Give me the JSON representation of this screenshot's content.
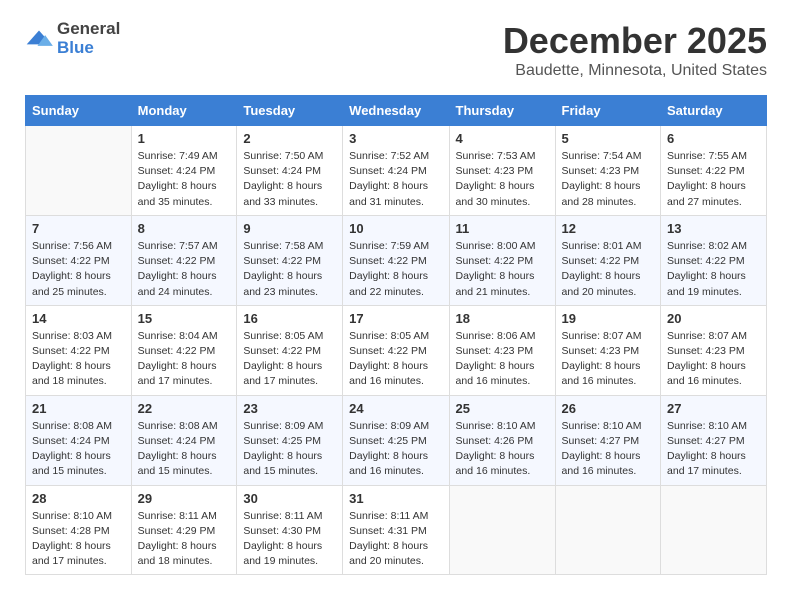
{
  "logo": {
    "general": "General",
    "blue": "Blue"
  },
  "header": {
    "month": "December 2025",
    "location": "Baudette, Minnesota, United States"
  },
  "weekdays": [
    "Sunday",
    "Monday",
    "Tuesday",
    "Wednesday",
    "Thursday",
    "Friday",
    "Saturday"
  ],
  "weeks": [
    [
      {
        "day": "",
        "content": ""
      },
      {
        "day": "1",
        "content": "Sunrise: 7:49 AM\nSunset: 4:24 PM\nDaylight: 8 hours\nand 35 minutes."
      },
      {
        "day": "2",
        "content": "Sunrise: 7:50 AM\nSunset: 4:24 PM\nDaylight: 8 hours\nand 33 minutes."
      },
      {
        "day": "3",
        "content": "Sunrise: 7:52 AM\nSunset: 4:24 PM\nDaylight: 8 hours\nand 31 minutes."
      },
      {
        "day": "4",
        "content": "Sunrise: 7:53 AM\nSunset: 4:23 PM\nDaylight: 8 hours\nand 30 minutes."
      },
      {
        "day": "5",
        "content": "Sunrise: 7:54 AM\nSunset: 4:23 PM\nDaylight: 8 hours\nand 28 minutes."
      },
      {
        "day": "6",
        "content": "Sunrise: 7:55 AM\nSunset: 4:22 PM\nDaylight: 8 hours\nand 27 minutes."
      }
    ],
    [
      {
        "day": "7",
        "content": "Sunrise: 7:56 AM\nSunset: 4:22 PM\nDaylight: 8 hours\nand 25 minutes."
      },
      {
        "day": "8",
        "content": "Sunrise: 7:57 AM\nSunset: 4:22 PM\nDaylight: 8 hours\nand 24 minutes."
      },
      {
        "day": "9",
        "content": "Sunrise: 7:58 AM\nSunset: 4:22 PM\nDaylight: 8 hours\nand 23 minutes."
      },
      {
        "day": "10",
        "content": "Sunrise: 7:59 AM\nSunset: 4:22 PM\nDaylight: 8 hours\nand 22 minutes."
      },
      {
        "day": "11",
        "content": "Sunrise: 8:00 AM\nSunset: 4:22 PM\nDaylight: 8 hours\nand 21 minutes."
      },
      {
        "day": "12",
        "content": "Sunrise: 8:01 AM\nSunset: 4:22 PM\nDaylight: 8 hours\nand 20 minutes."
      },
      {
        "day": "13",
        "content": "Sunrise: 8:02 AM\nSunset: 4:22 PM\nDaylight: 8 hours\nand 19 minutes."
      }
    ],
    [
      {
        "day": "14",
        "content": "Sunrise: 8:03 AM\nSunset: 4:22 PM\nDaylight: 8 hours\nand 18 minutes."
      },
      {
        "day": "15",
        "content": "Sunrise: 8:04 AM\nSunset: 4:22 PM\nDaylight: 8 hours\nand 17 minutes."
      },
      {
        "day": "16",
        "content": "Sunrise: 8:05 AM\nSunset: 4:22 PM\nDaylight: 8 hours\nand 17 minutes."
      },
      {
        "day": "17",
        "content": "Sunrise: 8:05 AM\nSunset: 4:22 PM\nDaylight: 8 hours\nand 16 minutes."
      },
      {
        "day": "18",
        "content": "Sunrise: 8:06 AM\nSunset: 4:23 PM\nDaylight: 8 hours\nand 16 minutes."
      },
      {
        "day": "19",
        "content": "Sunrise: 8:07 AM\nSunset: 4:23 PM\nDaylight: 8 hours\nand 16 minutes."
      },
      {
        "day": "20",
        "content": "Sunrise: 8:07 AM\nSunset: 4:23 PM\nDaylight: 8 hours\nand 16 minutes."
      }
    ],
    [
      {
        "day": "21",
        "content": "Sunrise: 8:08 AM\nSunset: 4:24 PM\nDaylight: 8 hours\nand 15 minutes."
      },
      {
        "day": "22",
        "content": "Sunrise: 8:08 AM\nSunset: 4:24 PM\nDaylight: 8 hours\nand 15 minutes."
      },
      {
        "day": "23",
        "content": "Sunrise: 8:09 AM\nSunset: 4:25 PM\nDaylight: 8 hours\nand 15 minutes."
      },
      {
        "day": "24",
        "content": "Sunrise: 8:09 AM\nSunset: 4:25 PM\nDaylight: 8 hours\nand 16 minutes."
      },
      {
        "day": "25",
        "content": "Sunrise: 8:10 AM\nSunset: 4:26 PM\nDaylight: 8 hours\nand 16 minutes."
      },
      {
        "day": "26",
        "content": "Sunrise: 8:10 AM\nSunset: 4:27 PM\nDaylight: 8 hours\nand 16 minutes."
      },
      {
        "day": "27",
        "content": "Sunrise: 8:10 AM\nSunset: 4:27 PM\nDaylight: 8 hours\nand 17 minutes."
      }
    ],
    [
      {
        "day": "28",
        "content": "Sunrise: 8:10 AM\nSunset: 4:28 PM\nDaylight: 8 hours\nand 17 minutes."
      },
      {
        "day": "29",
        "content": "Sunrise: 8:11 AM\nSunset: 4:29 PM\nDaylight: 8 hours\nand 18 minutes."
      },
      {
        "day": "30",
        "content": "Sunrise: 8:11 AM\nSunset: 4:30 PM\nDaylight: 8 hours\nand 19 minutes."
      },
      {
        "day": "31",
        "content": "Sunrise: 8:11 AM\nSunset: 4:31 PM\nDaylight: 8 hours\nand 20 minutes."
      },
      {
        "day": "",
        "content": ""
      },
      {
        "day": "",
        "content": ""
      },
      {
        "day": "",
        "content": ""
      }
    ]
  ]
}
